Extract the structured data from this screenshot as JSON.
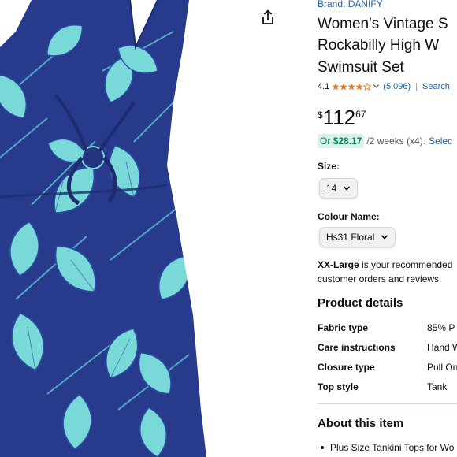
{
  "product": {
    "brand": "Brand: DANIFY",
    "title_lines": [
      "Women's Vintage S",
      "Rockabilly High W",
      "Swimsuit Set"
    ],
    "rating": {
      "value": "4.1",
      "stars": 4.1,
      "count": "(5,096)",
      "search": "Search"
    },
    "price": {
      "symbol": "$",
      "whole": "112",
      "fraction": "67"
    },
    "installment": {
      "prefix": "Or",
      "amount": "$28.17",
      "rest": "/2 weeks (x4).",
      "link": "Selec"
    }
  },
  "options": {
    "size_label": "Size:",
    "size_value": "14",
    "colour_label": "Colour Name:",
    "colour_value": "Hs31 Floral"
  },
  "recommendation": {
    "size": "XX-Large",
    "line1_rest": " is your recommended",
    "line2": "customer orders and reviews."
  },
  "product_details": {
    "heading": "Product details",
    "rows": [
      {
        "key": "Fabric type",
        "value": "85% P"
      },
      {
        "key": "Care instructions",
        "value": "Hand W"
      },
      {
        "key": "Closure type",
        "value": "Pull On"
      },
      {
        "key": "Top style",
        "value": "Tank"
      }
    ]
  },
  "about": {
    "heading": "About this item",
    "bullets": [
      "Plus Size Tankini Tops for Wo"
    ]
  },
  "icons": {
    "share": "share-icon",
    "chevron": "chevron-down-icon",
    "star": "star-icon"
  },
  "colors": {
    "link": "#2162a1",
    "star": "#de7921",
    "deal_green": "#067d62",
    "swimsuit_navy": "#283a8c",
    "leaf_teal": "#79d9d9"
  }
}
